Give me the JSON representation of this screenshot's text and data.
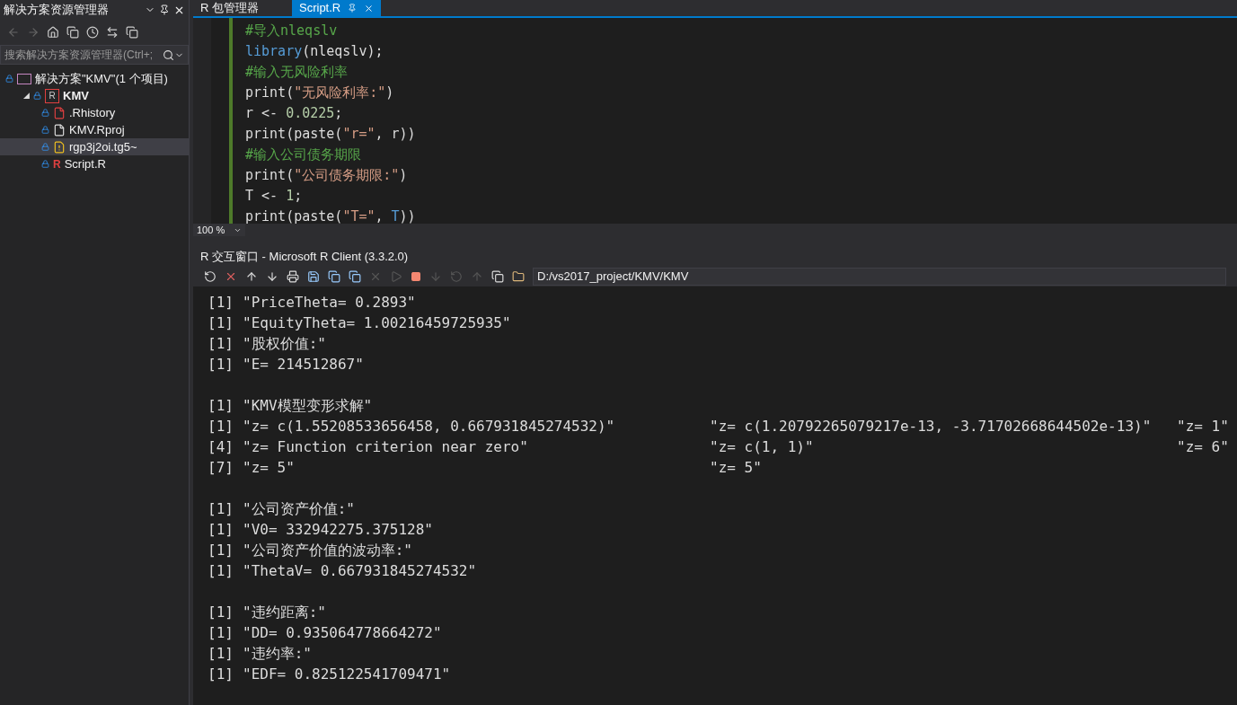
{
  "explorer": {
    "title": "解决方案资源管理器",
    "search": {
      "placeholder": "搜索解决方案资源管理器(Ctrl+;"
    },
    "tree": [
      {
        "label": "解决方案\"KMV\"(1 个项目)",
        "kind": "solution",
        "selected": false,
        "children": [
          {
            "label": "KMV",
            "kind": "project",
            "icon": "R",
            "expander": "◢",
            "selected": false,
            "children": [
              {
                "label": ".Rhistory",
                "kind": "history",
                "selected": false
              },
              {
                "label": "KMV.Rproj",
                "kind": "file",
                "selected": false
              },
              {
                "label": "rgp3j2oi.tg5~",
                "kind": "warning",
                "selected": true
              },
              {
                "label": "Script.R",
                "kind": "script",
                "icon": "R",
                "selected": false
              }
            ]
          }
        ]
      }
    ]
  },
  "editor": {
    "tabs": [
      {
        "label": "R 包管理器",
        "selected": false
      },
      {
        "label": "Script.R",
        "selected": true
      }
    ],
    "lines": [
      [
        {
          "text": "#导入nleqslv",
          "kind": "comment"
        }
      ],
      [
        {
          "text": "library",
          "kind": "func"
        },
        {
          "text": "(nleqslv);",
          "kind": "plain"
        }
      ],
      [
        {
          "text": "#输入无风险利率",
          "kind": "comment"
        }
      ],
      [
        {
          "text": "print(",
          "kind": "plain"
        },
        {
          "text": "\"无风险利率:\"",
          "kind": "string"
        },
        {
          "text": ")",
          "kind": "plain"
        }
      ],
      [
        {
          "text": "r <- ",
          "kind": "plain"
        },
        {
          "text": "0.0225",
          "kind": "number"
        },
        {
          "text": ";",
          "kind": "plain"
        }
      ],
      [
        {
          "text": "print(paste(",
          "kind": "plain"
        },
        {
          "text": "\"r=\"",
          "kind": "string"
        },
        {
          "text": ", r))",
          "kind": "plain"
        }
      ],
      [
        {
          "text": "#输入公司债务期限",
          "kind": "comment"
        }
      ],
      [
        {
          "text": "print(",
          "kind": "plain"
        },
        {
          "text": "\"公司债务期限:\"",
          "kind": "string"
        },
        {
          "text": ")",
          "kind": "plain"
        }
      ],
      [
        {
          "text": "T <- ",
          "kind": "plain"
        },
        {
          "text": "1",
          "kind": "number"
        },
        {
          "text": ";",
          "kind": "plain"
        }
      ],
      [
        {
          "text": "print(paste(",
          "kind": "plain"
        },
        {
          "text": "\"T=\"",
          "kind": "string"
        },
        {
          "text": ", ",
          "kind": "plain"
        },
        {
          "text": "T",
          "kind": "func"
        },
        {
          "text": "))",
          "kind": "plain"
        }
      ]
    ],
    "zoom": "100 %"
  },
  "console": {
    "title": "R 交互窗口 - Microsoft R Client (3.3.2.0)",
    "path": "D:/vs2017_project/KMV/KMV",
    "blocks": [
      [
        {
          "index": "[1]",
          "cells": [
            "\"PriceTheta= 0.2893\""
          ]
        },
        {
          "index": "[1]",
          "cells": [
            "\"EquityTheta= 1.00216459725935\""
          ]
        },
        {
          "index": "[1]",
          "cells": [
            "\"股权价值:\""
          ]
        },
        {
          "index": "[1]",
          "cells": [
            "\"E= 214512867\""
          ]
        }
      ],
      [
        {
          "index": "[1]",
          "cells": [
            "\"KMV模型变形求解\""
          ]
        },
        {
          "index": "[1]",
          "cells": [
            "\"z= c(1.55208533656458, 0.667931845274532)\"",
            "\"z= c(1.20792265079217e-13, -3.71702668644502e-13)\"",
            "\"z= 1\""
          ]
        },
        {
          "index": "[4]",
          "cells": [
            "\"z= Function criterion near zero\"",
            "\"z= c(1, 1)\"",
            "\"z= 6\""
          ]
        },
        {
          "index": "[7]",
          "cells": [
            "\"z= 5\"",
            "\"z= 5\""
          ]
        }
      ],
      [
        {
          "index": "[1]",
          "cells": [
            "\"公司资产价值:\""
          ]
        },
        {
          "index": "[1]",
          "cells": [
            "\"V0= 332942275.375128\""
          ]
        },
        {
          "index": "[1]",
          "cells": [
            "\"公司资产价值的波动率:\""
          ]
        },
        {
          "index": "[1]",
          "cells": [
            "\"ThetaV= 0.667931845274532\""
          ]
        }
      ],
      [
        {
          "index": "[1]",
          "cells": [
            "\"违约距离:\""
          ]
        },
        {
          "index": "[1]",
          "cells": [
            "\"DD= 0.935064778664272\""
          ]
        },
        {
          "index": "[1]",
          "cells": [
            "\"违约率:\""
          ]
        },
        {
          "index": "[1]",
          "cells": [
            "\"EDF= 0.825122541709471\""
          ]
        }
      ]
    ]
  }
}
